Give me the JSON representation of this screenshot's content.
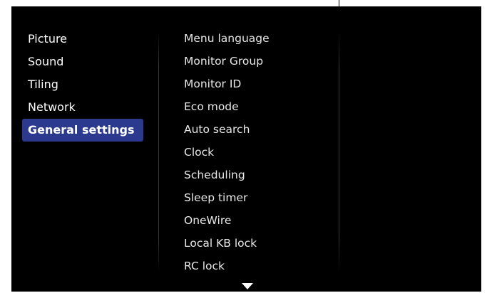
{
  "left_menu": {
    "items": [
      {
        "label": "Picture"
      },
      {
        "label": "Sound"
      },
      {
        "label": "Tiling"
      },
      {
        "label": "Network"
      },
      {
        "label": "General settings"
      }
    ],
    "selected": "General settings"
  },
  "submenu": {
    "items": [
      {
        "label": "Menu language"
      },
      {
        "label": "Monitor Group"
      },
      {
        "label": "Monitor ID"
      },
      {
        "label": "Eco mode"
      },
      {
        "label": "Auto search"
      },
      {
        "label": "Clock"
      },
      {
        "label": "Scheduling"
      },
      {
        "label": "Sleep timer"
      },
      {
        "label": "OneWire"
      },
      {
        "label": "Local KB lock"
      },
      {
        "label": "RC lock"
      }
    ]
  },
  "icons": {
    "scroll_down": "down-triangle-icon"
  },
  "colors": {
    "background": "#000000",
    "selection": "#2b3a8f",
    "text": "#ffffff"
  }
}
